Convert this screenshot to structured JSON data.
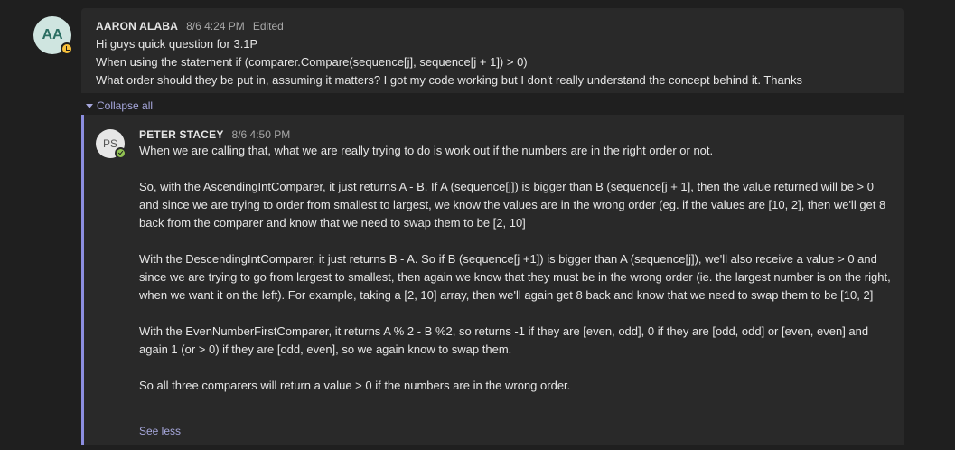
{
  "root_message": {
    "avatar_initials": "AA",
    "author": "AARON ALABA",
    "timestamp": "8/6 4:24 PM",
    "edited_label": "Edited",
    "lines": [
      "Hi guys quick question for 3.1P",
      "When using the statement if (comparer.Compare(sequence[j], sequence[j + 1]) > 0)",
      "What order should they be put in, assuming it matters? I got my code working but I don't really understand the concept behind it.  Thanks"
    ]
  },
  "collapse_all_label": "Collapse all",
  "reply": {
    "avatar_initials": "PS",
    "author": "PETER STACEY",
    "timestamp": "8/6 4:50 PM",
    "paragraphs": [
      "When we are calling that, what we are really trying to do is work out if the numbers are in the right order or not.",
      "So, with the AscendingIntComparer, it just returns A - B. If A (sequence[j]) is bigger than B (sequence[j + 1], then the value returned will be > 0 and since we are trying to order from smallest to largest, we know the values are in the wrong order (eg. if the values are [10, 2], then we'll get 8 back from the comparer and know that we need to swap them to be [2, 10]",
      "With the DescendingIntComparer, it just returns B - A. So if B (sequence[j +1]) is bigger than A (sequence[j]), we'll also receive a value > 0 and since we are trying to go from largest to smallest, then again we know that they must be in the wrong order (ie. the largest number is on the right, when we want it on the left). For example, taking a [2, 10] array, then we'll again get 8 back and know that we need to swap them to be [10, 2]",
      "With the EvenNumberFirstComparer, it returns A % 2 - B %2, so returns -1 if they are [even, odd], 0 if they are [odd, odd] or [even, even] and again 1 (or > 0) if they are [odd, even], so we again know to swap them.",
      "So all three comparers will return a value > 0 if the numbers are in the wrong order."
    ],
    "see_less_label": "See less"
  },
  "colors": {
    "background": "#1f1f1f",
    "card": "#292929",
    "accent": "#a6a7dc",
    "thread_bar": "#8c8ee0",
    "presence_away": "#f8c13c",
    "presence_available": "#92c353"
  }
}
